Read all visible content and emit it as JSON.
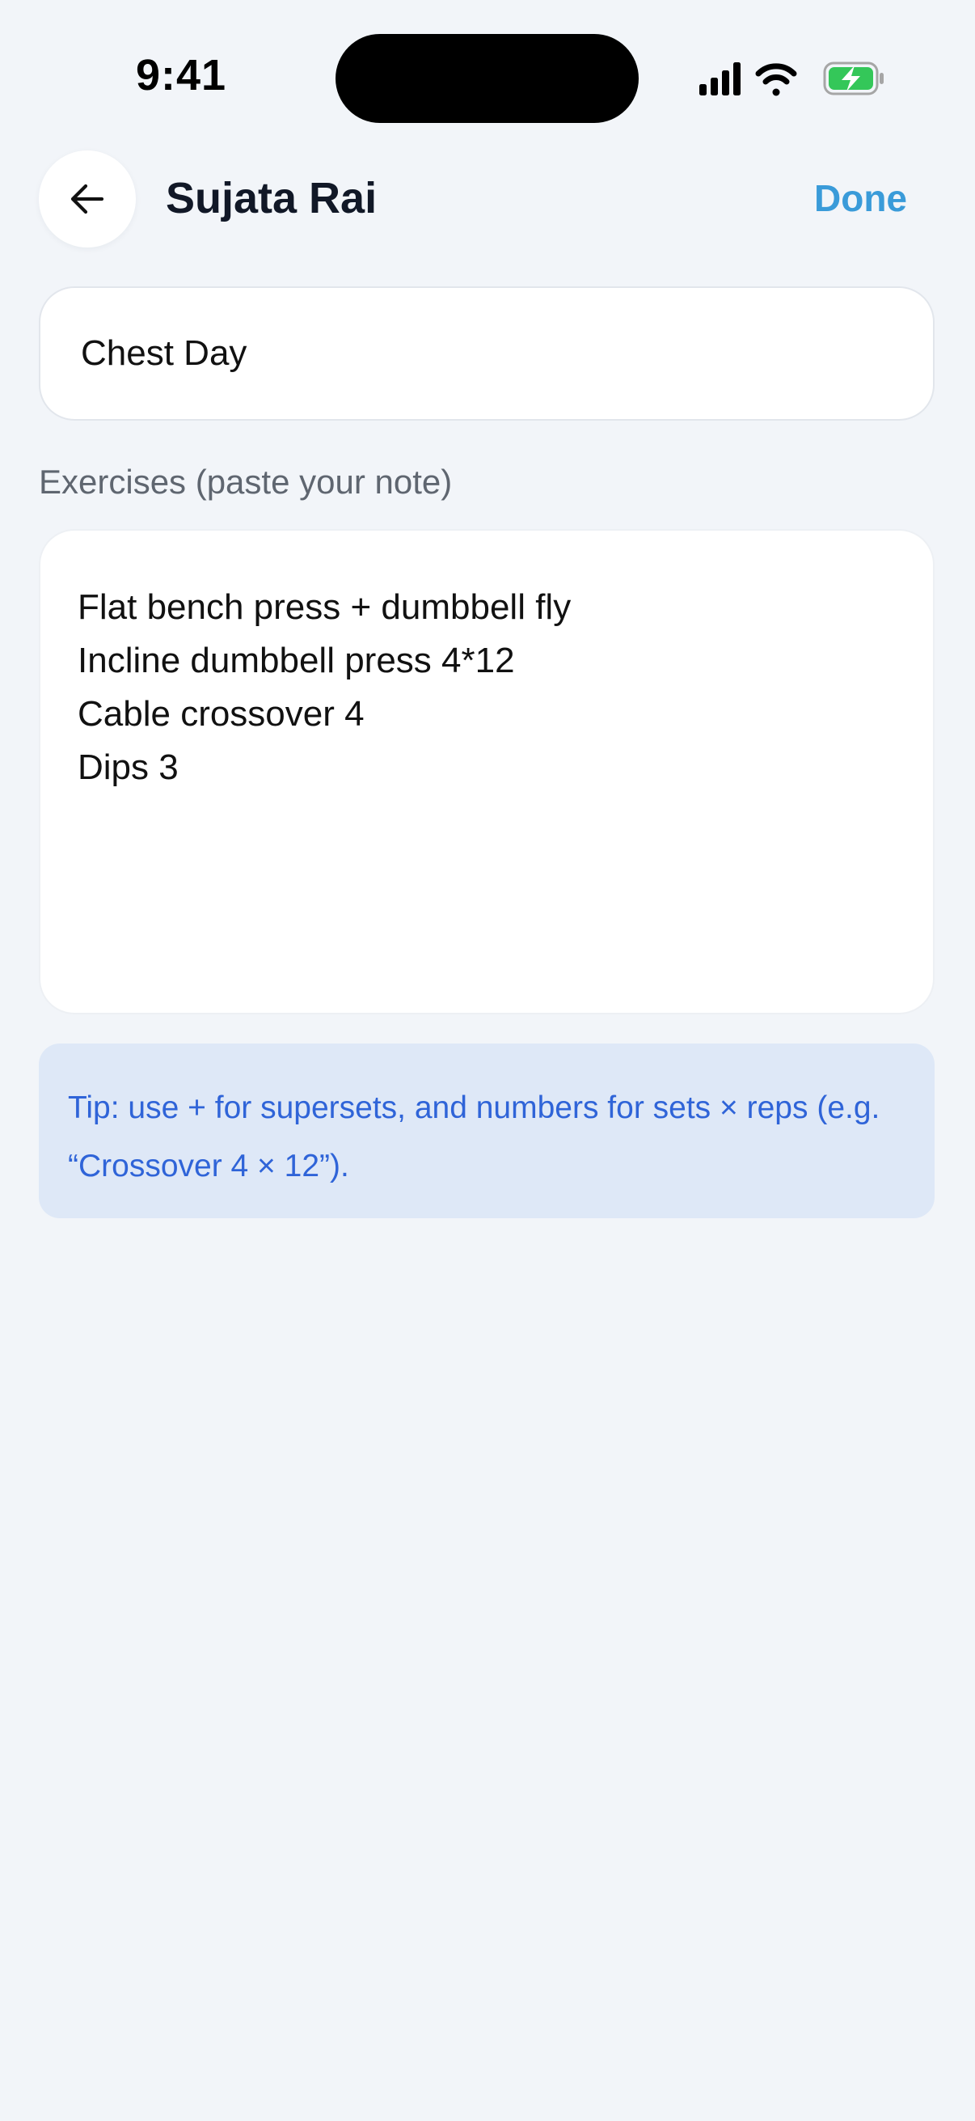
{
  "status_bar": {
    "time": "9:41",
    "icons": [
      "cellular-signal-icon",
      "wifi-icon",
      "battery-charging-icon"
    ]
  },
  "header": {
    "title": "Sujata Rai",
    "back_icon": "arrow-left-icon",
    "done_label": "Done"
  },
  "workout": {
    "name_value": "Chest Day"
  },
  "exercises": {
    "label": "Exercises (paste your note)",
    "lines": [
      "Flat bench press + dumbbell fly",
      "Incline dumbbell press 4*12",
      "Cable crossover 4",
      "Dips 3"
    ]
  },
  "tip": {
    "text": "Tip: use + for supersets, and numbers for sets × reps (e.g. “Crossover 4 × 12”)."
  },
  "colors": {
    "background": "#f2f5f9",
    "accent": "#3a9bd9",
    "tip_background": "#dee8f7",
    "tip_text": "#2f64d8",
    "battery_green": "#34c759"
  }
}
